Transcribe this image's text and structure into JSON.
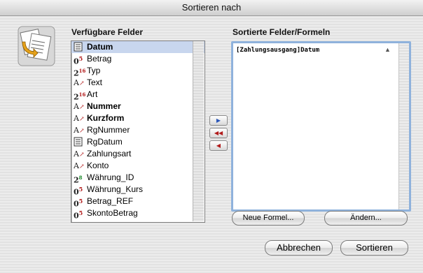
{
  "window": {
    "title": "Sortieren nach"
  },
  "available": {
    "heading": "Verfügbare Felder",
    "fields": [
      {
        "label": "Datum",
        "type": "date-icon",
        "bold": true,
        "selected": true
      },
      {
        "label": "Betrag",
        "type": "number-icon",
        "bold": false
      },
      {
        "label": "Typ",
        "type": "calc-icon",
        "bold": false
      },
      {
        "label": "Text",
        "type": "text-icon",
        "bold": false
      },
      {
        "label": "Art",
        "type": "calc-icon",
        "bold": false
      },
      {
        "label": "Nummer",
        "type": "text-icon",
        "bold": true
      },
      {
        "label": "Kurzform",
        "type": "text-icon",
        "bold": true
      },
      {
        "label": "RgNummer",
        "type": "text-icon",
        "bold": false
      },
      {
        "label": "RgDatum",
        "type": "date-icon",
        "bold": false
      },
      {
        "label": "Zahlungsart",
        "type": "text-icon",
        "bold": false
      },
      {
        "label": "Konto",
        "type": "text-icon",
        "bold": false
      },
      {
        "label": "Währung_ID",
        "type": "integer-icon",
        "bold": false
      },
      {
        "label": "Währung_Kurs",
        "type": "number-icon",
        "bold": false
      },
      {
        "label": "Betrag_REF",
        "type": "number-icon",
        "bold": false
      },
      {
        "label": "SkontoBetrag",
        "type": "number-icon",
        "bold": false
      }
    ]
  },
  "sorted": {
    "heading": "Sortierte Felder/Formeln",
    "items": [
      {
        "label": "[Zahlungsausgang]Datum",
        "direction_icon": "ascending-triangle-icon"
      }
    ]
  },
  "buttons": {
    "add": "▶",
    "add_all": "◀◀",
    "remove": "◀",
    "neue_formel": "Neue Formel...",
    "andern": "Ändern...",
    "abbrechen": "Abbrechen",
    "sortieren": "Sortieren"
  },
  "type_glyphs": {
    "date-icon": "▤",
    "number-icon": "0⁵",
    "calc-icon": "2¹⁶",
    "text-icon": "A",
    "integer-icon": "2⁸"
  },
  "colors": {
    "selection": "#c8d6ee",
    "focus_ring": "#8fb2dc",
    "arrow_blue": "#2b57b8",
    "arrow_red": "#b21b1b"
  }
}
